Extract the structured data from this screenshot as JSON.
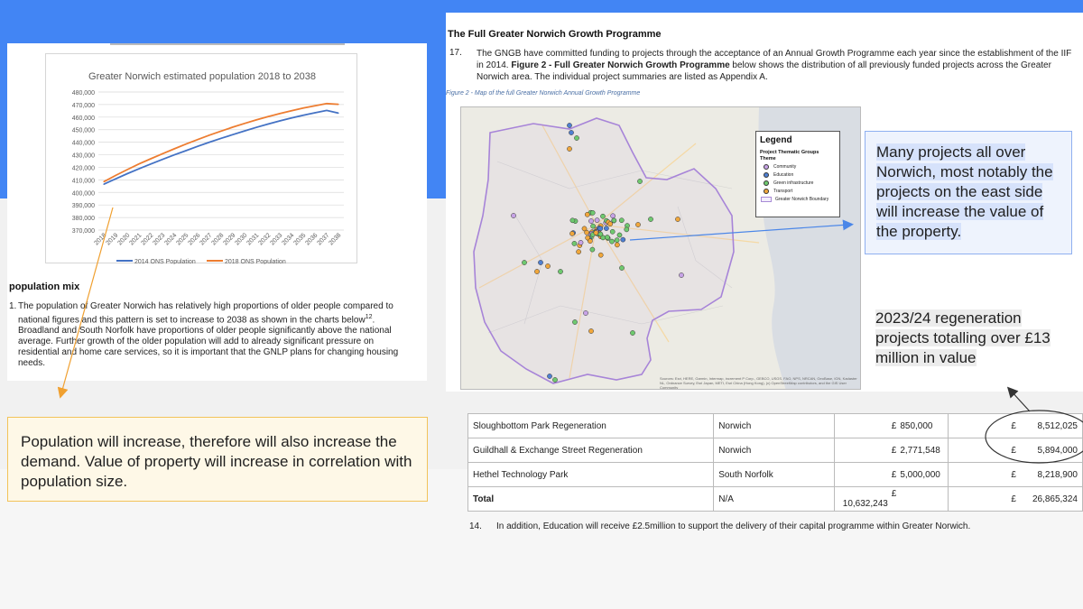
{
  "left_doc": {
    "chart": {
      "title": "Greater Norwich estimated population 2018 to 2038"
    },
    "section_heading": "population mix",
    "paragraph": {
      "number": "1.",
      "text_1": "The population of Greater Norwich has relatively high proportions of older people compared to national figures and this pattern is set to increase to 2038 as shown in the charts below",
      "footnote": "12",
      "text_2": ". Broadland and South Norfolk have proportions of older people significantly above the national average. Further growth of the older population will add to already significant pressure on residential and home care services, so it is important that the GNLP plans for changing housing needs."
    }
  },
  "chart_data": {
    "type": "line",
    "title": "Greater Norwich estimated population 2018 to 2038",
    "x": [
      "2018",
      "2019",
      "2020",
      "2021",
      "2022",
      "2023",
      "2024",
      "2025",
      "2026",
      "2027",
      "2028",
      "2029",
      "2030",
      "2031",
      "2032",
      "2033",
      "2034",
      "2035",
      "2036",
      "2037",
      "2038"
    ],
    "yticks": [
      "480,000",
      "470,000",
      "460,000",
      "450,000",
      "440,000",
      "430,000",
      "420,000",
      "410,000",
      "400,000",
      "390,000",
      "380,000",
      "370,000"
    ],
    "ylim": [
      370000,
      480000
    ],
    "grid": true,
    "legend_position": "bottom",
    "series": [
      {
        "name": "2014 ONS Population",
        "color": "#4472c4",
        "values": [
          406500,
          410800,
          414900,
          418800,
          422600,
          426300,
          429900,
          433300,
          436700,
          440000,
          443100,
          446100,
          449000,
          451800,
          454500,
          457000,
          459300,
          461500,
          463500,
          465300,
          463200
        ]
      },
      {
        "name": "2018 ONS Population",
        "color": "#ed7d31",
        "values": [
          408500,
          413500,
          418200,
          422700,
          426800,
          430800,
          434700,
          438500,
          442100,
          445600,
          448900,
          452000,
          455000,
          457800,
          460400,
          462800,
          465100,
          467200,
          469100,
          470800,
          470200
        ]
      }
    ]
  },
  "note_left": {
    "text": "Population will increase, therefore will also increase the demand. Value of property will increase in correlation with population size."
  },
  "right_doc": {
    "title": "The Full Greater Norwich Growth Programme",
    "para_number": "17.",
    "para_text_1": "The GNGB have committed funding to projects through the acceptance of an Annual Growth Programme each year since the establishment of the IIF in 2014. ",
    "para_bold": "Figure 2 - Full Greater Norwich Growth Programme",
    "para_text_2": " below shows the distribution of all previously funded projects across the Greater Norwich area. The individual project summaries are listed as Appendix A.",
    "figure_caption": "Figure 2 - Map of the full Greater Norwich Annual Growth Programme",
    "legend": {
      "title": "Legend",
      "subtitle": "Project Thematic Groups",
      "theme_label": "Theme",
      "items": [
        {
          "label": "Community",
          "color": "#c7a3e6"
        },
        {
          "label": "Education",
          "color": "#4f7fd1"
        },
        {
          "label": "Green infrastructure",
          "color": "#6fc96f"
        },
        {
          "label": "Transport",
          "color": "#f0a73c"
        }
      ],
      "boundary_label": "Greater Norwich Boundary"
    },
    "map_credits": "Sources: Esri, HERE, Garmin, Intermap, increment P Corp., GEBCO, USGS, FAO, NPS, NRCAN, GeoBase, IGN, Kadaster NL, Ordnance Survey, Esri Japan, METI, Esri China (Hong Kong), (c) OpenStreetMap contributors, and the GIS User Community"
  },
  "note_right_1": {
    "text": "Many projects all over Norwich, most notably the projects on the east side will increase the value of the property."
  },
  "note_right_2": {
    "text": "2023/24 regeneration projects totalling over £13 million in value"
  },
  "table": {
    "rows": [
      {
        "project": "Sloughbottom Park Regeneration",
        "area": "Norwich",
        "cur1": "£",
        "amount": "850,000",
        "cur2": "£",
        "total": "8,512,025"
      },
      {
        "project": "Guildhall & Exchange Street Regeneration",
        "area": "Norwich",
        "cur1": "£",
        "amount": "2,771,548",
        "cur2": "£",
        "total": "5,894,000"
      },
      {
        "project": "Hethel Technology Park",
        "area": "South Norfolk",
        "cur1": "£",
        "amount": "5,000,000",
        "cur2": "£",
        "total": "8,218,900"
      },
      {
        "project": "Total",
        "area": "N/A",
        "cur1": "£",
        "amount": "10,632,243",
        "cur2": "£",
        "total": "26,865,324"
      }
    ]
  },
  "para14": {
    "number": "14.",
    "text": "In addition, Education will receive £2.5million to support the delivery of their capital programme within Greater Norwich."
  }
}
